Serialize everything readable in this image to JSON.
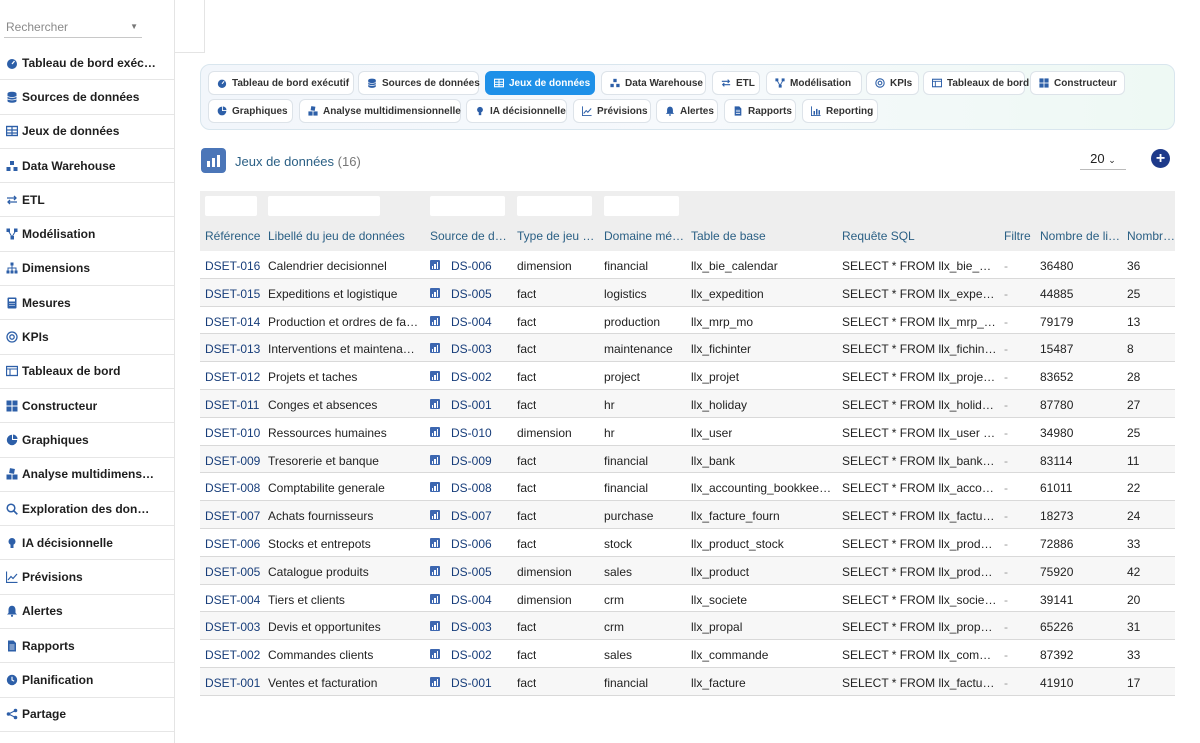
{
  "sidebar": {
    "search_placeholder": "Rechercher",
    "items": [
      {
        "label": "Tableau de bord exéc…",
        "icon": "dashboard-gauge-icon"
      },
      {
        "label": "Sources de données",
        "icon": "database-icon"
      },
      {
        "label": "Jeux de données",
        "icon": "table-icon"
      },
      {
        "label": "Data Warehouse",
        "icon": "warehouse-icon"
      },
      {
        "label": "ETL",
        "icon": "exchange-arrows-icon"
      },
      {
        "label": "Modélisation",
        "icon": "model-nodes-icon"
      },
      {
        "label": "Dimensions",
        "icon": "hierarchy-icon"
      },
      {
        "label": "Mesures",
        "icon": "calculator-icon"
      },
      {
        "label": "KPIs",
        "icon": "target-icon"
      },
      {
        "label": "Tableaux de bord",
        "icon": "board-icon"
      },
      {
        "label": "Constructeur",
        "icon": "grid-blocks-icon"
      },
      {
        "label": "Graphiques",
        "icon": "pie-chart-icon"
      },
      {
        "label": "Analyse multidimens…",
        "icon": "cubes-icon"
      },
      {
        "label": "Exploration des don…",
        "icon": "magnifier-icon"
      },
      {
        "label": "IA décisionnelle",
        "icon": "lightbulb-icon"
      },
      {
        "label": "Prévisions",
        "icon": "trend-chart-icon"
      },
      {
        "label": "Alertes",
        "icon": "bell-icon"
      },
      {
        "label": "Rapports",
        "icon": "document-icon"
      },
      {
        "label": "Planification",
        "icon": "clock-icon"
      },
      {
        "label": "Partage",
        "icon": "share-icon"
      }
    ]
  },
  "tabs": [
    {
      "label": "Tableau de bord exécutif",
      "icon": "dashboard-gauge-icon",
      "active": false
    },
    {
      "label": "Sources de données",
      "icon": "database-icon",
      "active": false
    },
    {
      "label": "Jeux de données",
      "icon": "table-icon",
      "active": true
    },
    {
      "label": "Data Warehouse",
      "icon": "warehouse-icon",
      "active": false
    },
    {
      "label": "ETL",
      "icon": "exchange-arrows-icon",
      "active": false
    },
    {
      "label": "Modélisation",
      "icon": "model-nodes-icon",
      "active": false
    },
    {
      "label": "KPIs",
      "icon": "target-icon",
      "active": false
    },
    {
      "label": "Tableaux de bord",
      "icon": "board-icon",
      "active": false
    },
    {
      "label": "Constructeur",
      "icon": "grid-blocks-icon",
      "active": false
    },
    {
      "label": "Graphiques",
      "icon": "pie-chart-icon",
      "active": false
    },
    {
      "label": "Analyse multidimensionnelle",
      "icon": "cubes-icon",
      "active": false
    },
    {
      "label": "IA décisionnelle",
      "icon": "lightbulb-icon",
      "active": false
    },
    {
      "label": "Prévisions",
      "icon": "trend-chart-icon",
      "active": false
    },
    {
      "label": "Alertes",
      "icon": "bell-icon",
      "active": false
    },
    {
      "label": "Rapports",
      "icon": "document-icon",
      "active": false
    },
    {
      "label": "Reporting",
      "icon": "bar-chart-icon",
      "active": false
    }
  ],
  "page": {
    "title": "Jeux de données",
    "count": "(16)",
    "per_page": "20",
    "accent": "#1e90e8"
  },
  "table": {
    "headers": [
      "Référence",
      "Libellé du jeu de données",
      "Source de d…",
      "Type de jeu …",
      "Domaine mé…",
      "Table de base",
      "Requête SQL",
      "Filtre",
      "Nombre de li…",
      "Nombre d…"
    ],
    "rows": [
      [
        "DSET-016",
        "Calendrier decisionnel",
        "DS-006",
        "dimension",
        "financial",
        "llx_bie_calendar",
        "SELECT * FROM llx_bie_ca…",
        "-",
        "36480",
        "36"
      ],
      [
        "DSET-015",
        "Expeditions et logistique",
        "DS-005",
        "fact",
        "logistics",
        "llx_expedition",
        "SELECT * FROM llx_expedi…",
        "-",
        "44885",
        "25"
      ],
      [
        "DSET-014",
        "Production et ordres de fabr…",
        "DS-004",
        "fact",
        "production",
        "llx_mrp_mo",
        "SELECT * FROM llx_mrp_…",
        "-",
        "79179",
        "13"
      ],
      [
        "DSET-013",
        "Interventions et maintenance",
        "DS-003",
        "fact",
        "maintenance",
        "llx_fichinter",
        "SELECT * FROM llx_fichint…",
        "-",
        "15487",
        "8"
      ],
      [
        "DSET-012",
        "Projets et taches",
        "DS-002",
        "fact",
        "project",
        "llx_projet",
        "SELECT * FROM llx_projet …",
        "-",
        "83652",
        "28"
      ],
      [
        "DSET-011",
        "Conges et absences",
        "DS-001",
        "fact",
        "hr",
        "llx_holiday",
        "SELECT * FROM llx_holida…",
        "-",
        "87780",
        "27"
      ],
      [
        "DSET-010",
        "Ressources humaines",
        "DS-010",
        "dimension",
        "hr",
        "llx_user",
        "SELECT * FROM llx_user …",
        "-",
        "34980",
        "25"
      ],
      [
        "DSET-009",
        "Tresorerie et banque",
        "DS-009",
        "fact",
        "financial",
        "llx_bank",
        "SELECT * FROM llx_bank …",
        "-",
        "83114",
        "11"
      ],
      [
        "DSET-008",
        "Comptabilite generale",
        "DS-008",
        "fact",
        "financial",
        "llx_accounting_bookkeeping",
        "SELECT * FROM llx_accou…",
        "-",
        "61011",
        "22"
      ],
      [
        "DSET-007",
        "Achats fournisseurs",
        "DS-007",
        "fact",
        "purchase",
        "llx_facture_fourn",
        "SELECT * FROM llx_factur…",
        "-",
        "18273",
        "24"
      ],
      [
        "DSET-006",
        "Stocks et entrepots",
        "DS-006",
        "fact",
        "stock",
        "llx_product_stock",
        "SELECT * FROM llx_produ…",
        "-",
        "72886",
        "33"
      ],
      [
        "DSET-005",
        "Catalogue produits",
        "DS-005",
        "dimension",
        "sales",
        "llx_product",
        "SELECT * FROM llx_produ…",
        "-",
        "75920",
        "42"
      ],
      [
        "DSET-004",
        "Tiers et clients",
        "DS-004",
        "dimension",
        "crm",
        "llx_societe",
        "SELECT * FROM llx_societ…",
        "-",
        "39141",
        "20"
      ],
      [
        "DSET-003",
        "Devis et opportunites",
        "DS-003",
        "fact",
        "crm",
        "llx_propal",
        "SELECT * FROM llx_propal…",
        "-",
        "65226",
        "31"
      ],
      [
        "DSET-002",
        "Commandes clients",
        "DS-002",
        "fact",
        "sales",
        "llx_commande",
        "SELECT * FROM llx_comm…",
        "-",
        "87392",
        "33"
      ],
      [
        "DSET-001",
        "Ventes et facturation",
        "DS-001",
        "fact",
        "financial",
        "llx_facture",
        "SELECT * FROM llx_factur…",
        "-",
        "41910",
        "17"
      ]
    ]
  }
}
